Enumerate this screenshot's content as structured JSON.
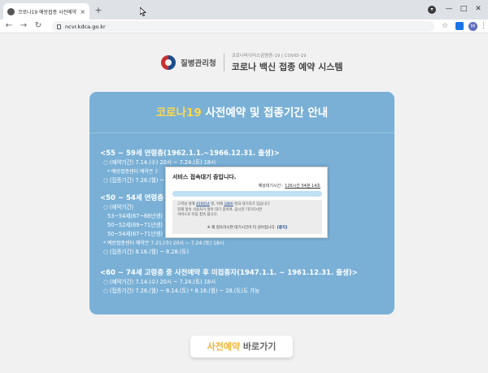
{
  "browser": {
    "tab_title": "코로나19 예방접종 사전예약 시스",
    "tab_close": "×",
    "new_tab": "+",
    "url": "ncvr.kdca.go.kr",
    "win_min": "—",
    "win_max": "□",
    "win_close": "✕",
    "nav_back": "←",
    "nav_forward": "→",
    "nav_reload": "↻",
    "star": "☆",
    "profile_initial": "M",
    "menu": "⋮"
  },
  "header": {
    "org_name": "질병관리청",
    "system_small": "코로나바이러스감염증-19 | COVID-19",
    "system_title": "코로나 백신 접종 예약 시스템"
  },
  "card": {
    "title_highlight": "코로나19",
    "title_rest": " 사전예약 및 접종기간 안내",
    "group1": {
      "title": "<55 ~ 59세 연령층(1962.1.1.~1966.12.31. 출생)>",
      "lines": [
        "○ (예약기간) 7.14.(수) 20시 ~ 7.24.(토) 18시",
        "* 예방접종센터 예약은 7",
        "○ (접종기간) 7.26.(월) ~"
      ]
    },
    "group2": {
      "title": "<50 ~ 54세 연령층",
      "lines": [
        "○ (예약기간)",
        "53~54세(67~68년생)",
        "50~52세(69~71년생)",
        "50~54세(67~71년생) 7.21.(수) 20시 ~ 7.24.(토) 18시",
        "* 예방접종센터 예약은 7.21.(수) 20시 ~ 7.24.(토) 18시",
        "○ (접종기간) 8.16.(월) ~ 8.28.(토)"
      ]
    },
    "group3": {
      "title": "<60 ~ 74세 고령층 중 사전예약 후 미접종자(1947.1.1. ~ 1961.12.31. 출생)>",
      "lines": [
        "○ (예약기간) 7.14.(수) 20시 ~ 7.24.(토) 18시",
        "○ (접종기간) 7.26.(월) ~ 8.14.(토)     * 8.16.(월) ~ 28.(토)도 가능"
      ]
    }
  },
  "wait_modal": {
    "title": "서비스 접속대기 중입니다.",
    "eta_label": "예상대기시간 : ",
    "eta_value": "126시간 54분 14초",
    "progress": 0.0,
    "msg_prefix": "고객님 앞에 ",
    "msg_ahead": "456654",
    "msg_mid": " 명, 뒤에 ",
    "msg_behind": "1866",
    "msg_suffix": " 명의 대기자가 있습니다.",
    "msg_line2": "현재 접속 사용자가 많아 대기 중이며, 잠시만 기다리시면",
    "msg_line3": "서비스로 자동 접속 됩니다.",
    "cut_pre": "※ 재 접속하시면 대기시간이 더 길어집니다. ",
    "cut_link": "[중지]"
  },
  "cta": {
    "highlight": "사전예약",
    "rest": " 바로가기"
  },
  "colors": {
    "card_bg": "#7ab0d6",
    "title_highlight": "#ffd84a",
    "cta_highlight": "#f1b32f",
    "progress_bg": "#bfe0f5"
  }
}
